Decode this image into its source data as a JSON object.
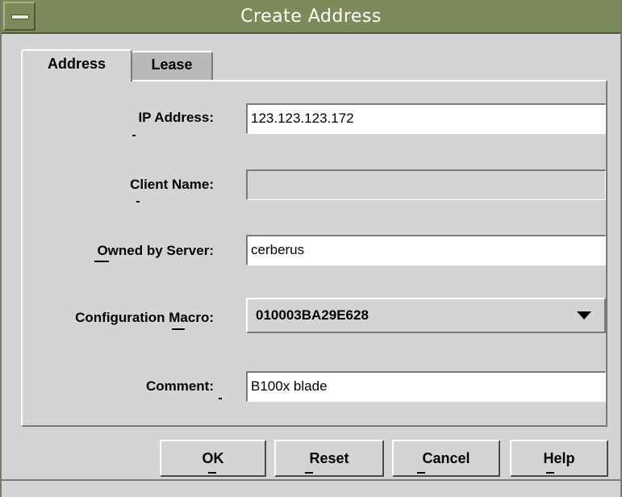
{
  "window": {
    "title": "Create Address"
  },
  "tabs": [
    {
      "label": "Address",
      "selected": true
    },
    {
      "label": "Lease",
      "selected": false
    }
  ],
  "form": {
    "ip_address": {
      "label": "IP Address:",
      "value": "123.123.123.172"
    },
    "client_name": {
      "label": "Client Name:",
      "value": "",
      "enabled": false
    },
    "owned_by_server": {
      "label": "Owned by Server:",
      "value": "cerberus"
    },
    "configuration_macro": {
      "label": "Configuration Macro:",
      "value": "010003BA29E628"
    },
    "comment": {
      "label": "Comment:",
      "value": "B100x blade"
    }
  },
  "buttons": {
    "ok": "OK",
    "reset": "Reset",
    "cancel": "Cancel",
    "help": "Help"
  },
  "icons": {
    "window_menu": "window-menu-icon",
    "dropdown": "chevron-down-icon"
  },
  "colors": {
    "titlebar": "#7d8a5a",
    "background": "#d4d4d4",
    "field": "#ffffff"
  }
}
